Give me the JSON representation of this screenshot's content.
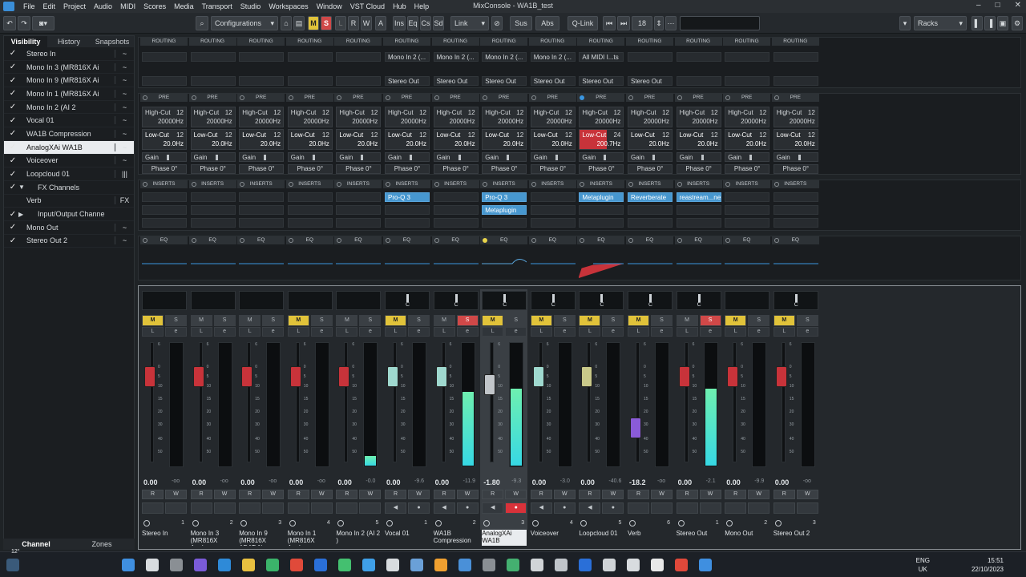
{
  "app": {
    "title": "MixConsole - WA1B_test",
    "menu": [
      "File",
      "Edit",
      "Project",
      "Audio",
      "MIDI",
      "Scores",
      "Media",
      "Transport",
      "Studio",
      "Workspaces",
      "Window",
      "VST Cloud",
      "Hub",
      "Help"
    ]
  },
  "toolbar": {
    "configurations_label": "Configurations",
    "m_label": "M",
    "s_label": "S",
    "l_label": "L",
    "r_label": "R",
    "w_label": "W",
    "a_label": "A",
    "ins_label": "Ins",
    "eq_label": "Eq",
    "cs_label": "Cs",
    "sd_label": "Sd",
    "link_label": "Link",
    "sus_label": "Sus",
    "abs_label": "Abs",
    "qlink_label": "Q-Link",
    "channel_count": "18",
    "racks_label": "Racks"
  },
  "left_panel": {
    "tabs": [
      "Visibility",
      "History",
      "Snapshots"
    ],
    "bottom_tabs": [
      "Channel",
      "Zones"
    ],
    "items": [
      {
        "label": "Stereo In",
        "check": "✓",
        "icon": "~"
      },
      {
        "label": "Mono In 3 (MR816X Ai",
        "check": "✓",
        "icon": "~"
      },
      {
        "label": "Mono In 9 (MR816X Ai",
        "check": "✓",
        "icon": "~"
      },
      {
        "label": "Mono In 1 (MR816X Ai",
        "check": "✓",
        "icon": "~"
      },
      {
        "label": "Mono In 2 (AI 2",
        "check": "✓",
        "icon": "~"
      },
      {
        "label": "Vocal 01",
        "check": "✓",
        "icon": "~"
      },
      {
        "label": "WA1B Compression",
        "check": "✓",
        "icon": "~"
      },
      {
        "label": "AnalogXAi WA1B",
        "check": "✓",
        "icon": "~"
      },
      {
        "label": "Voiceover",
        "check": "✓",
        "icon": "~"
      },
      {
        "label": "Loopcloud 01",
        "check": "✓",
        "icon": "|||"
      },
      {
        "label": "FX Channels",
        "check": "✓",
        "icon": ""
      },
      {
        "label": "Verb",
        "check": "",
        "icon": "FX"
      },
      {
        "label": "Input/Output Channe",
        "check": "✓",
        "icon": ""
      },
      {
        "label": "Mono Out",
        "check": "✓",
        "icon": "~"
      },
      {
        "label": "Stereo Out 2",
        "check": "✓",
        "icon": "~"
      }
    ]
  },
  "racks": {
    "routing_label": "ROUTING",
    "pre_label": "PRE",
    "inserts_label": "INSERTS",
    "eq_label": "EQ",
    "high_cut": "High-Cut",
    "high_cut_val": "20000Hz",
    "low_cut": "Low-Cut",
    "low_cut_val": "20.0Hz",
    "low_cut_val_active": "200.7Hz",
    "gain_label": "Gain",
    "phase_label": "Phase 0°",
    "slope": "12",
    "slope_active": "24"
  },
  "channels": [
    {
      "name": "Stereo In",
      "num": "1",
      "value": "0.00",
      "peak": "-oo",
      "routing": [
        "",
        ""
      ],
      "inserts": [
        "",
        ""
      ]
    },
    {
      "name": "Mono In 3 (MR816X Analog",
      "num": "2",
      "value": "0.00",
      "peak": "-oo",
      "routing": [
        "",
        ""
      ],
      "inserts": [
        "",
        ""
      ]
    },
    {
      "name": "Mono In 9 (MR816X ADAT 1)",
      "num": "3",
      "value": "0.00",
      "peak": "-oo",
      "routing": [
        "",
        ""
      ],
      "inserts": [
        "",
        ""
      ]
    },
    {
      "name": "Mono In 1 (MR816X Analog",
      "num": "4",
      "value": "0.00",
      "peak": "-oo",
      "routing": [
        "",
        ""
      ],
      "inserts": [
        "",
        ""
      ]
    },
    {
      "name": "Mono In 2 (AI 2 )",
      "num": "5",
      "value": "0.00",
      "peak": "-0.0",
      "routing": [
        "",
        ""
      ],
      "inserts": [
        "",
        ""
      ]
    },
    {
      "name": "Vocal 01",
      "num": "1",
      "value": "0.00",
      "peak": "-9.6",
      "routing": [
        "Mono In 2 (...",
        "Stereo Out"
      ],
      "inserts": [
        "Pro-Q 3",
        ""
      ]
    },
    {
      "name": "WA1B Compression",
      "num": "2",
      "value": "0.00",
      "peak": "-11.9",
      "routing": [
        "Mono In 2 (...",
        "Stereo Out"
      ],
      "inserts": [
        "",
        ""
      ]
    },
    {
      "name": "AnalogXAi WA1B",
      "num": "3",
      "value": "-1.80",
      "peak": "-9.3",
      "routing": [
        "Mono In 2 (...",
        "Stereo Out"
      ],
      "inserts": [
        "Pro-Q 3",
        "Metaplugin"
      ]
    },
    {
      "name": "Voiceover",
      "num": "4",
      "value": "0.00",
      "peak": "-3.0",
      "routing": [
        "Mono In 2 (...",
        "Stereo Out"
      ],
      "inserts": [
        "",
        ""
      ]
    },
    {
      "name": "Loopcloud 01",
      "num": "5",
      "value": "0.00",
      "peak": "-40.6",
      "routing": [
        "All MIDI I...ts",
        "Stereo Out"
      ],
      "inserts": [
        "Metaplugin",
        ""
      ]
    },
    {
      "name": "Verb",
      "num": "6",
      "value": "-18.2",
      "peak": "-oo",
      "routing": [
        "",
        "Stereo Out"
      ],
      "inserts": [
        "Reverberate",
        ""
      ]
    },
    {
      "name": "Stereo Out",
      "num": "1",
      "value": "0.00",
      "peak": "-2.1",
      "routing": [
        "",
        ""
      ],
      "inserts": [
        "reastream...ne",
        ""
      ]
    },
    {
      "name": "Mono Out",
      "num": "2",
      "value": "0.00",
      "peak": "-9.9",
      "routing": [
        "",
        ""
      ],
      "inserts": [
        "",
        ""
      ]
    },
    {
      "name": "Stereo Out 2",
      "num": "3",
      "value": "0.00",
      "peak": "-oo",
      "routing": [
        "",
        ""
      ],
      "inserts": [
        "",
        ""
      ]
    }
  ],
  "strip_labels": {
    "m": "M",
    "s": "S",
    "l": "L",
    "e": "e",
    "r": "R",
    "w": "W",
    "c": "C"
  },
  "colors": {
    "mute_yellow": "#e1c33a",
    "solo_red": "#d04848",
    "fader_red": "#c8333a",
    "fader_teal": "#9fd9cf",
    "fader_khaki": "#c9c98a",
    "fader_purple": "#8a5bd8",
    "meter_green": "#4ee4c0",
    "insert_blue": "#4797cf"
  },
  "taskbar": {
    "weather": "12°",
    "lang": "ENG",
    "region": "UK",
    "time": "15:51",
    "date": "22/10/2023"
  }
}
